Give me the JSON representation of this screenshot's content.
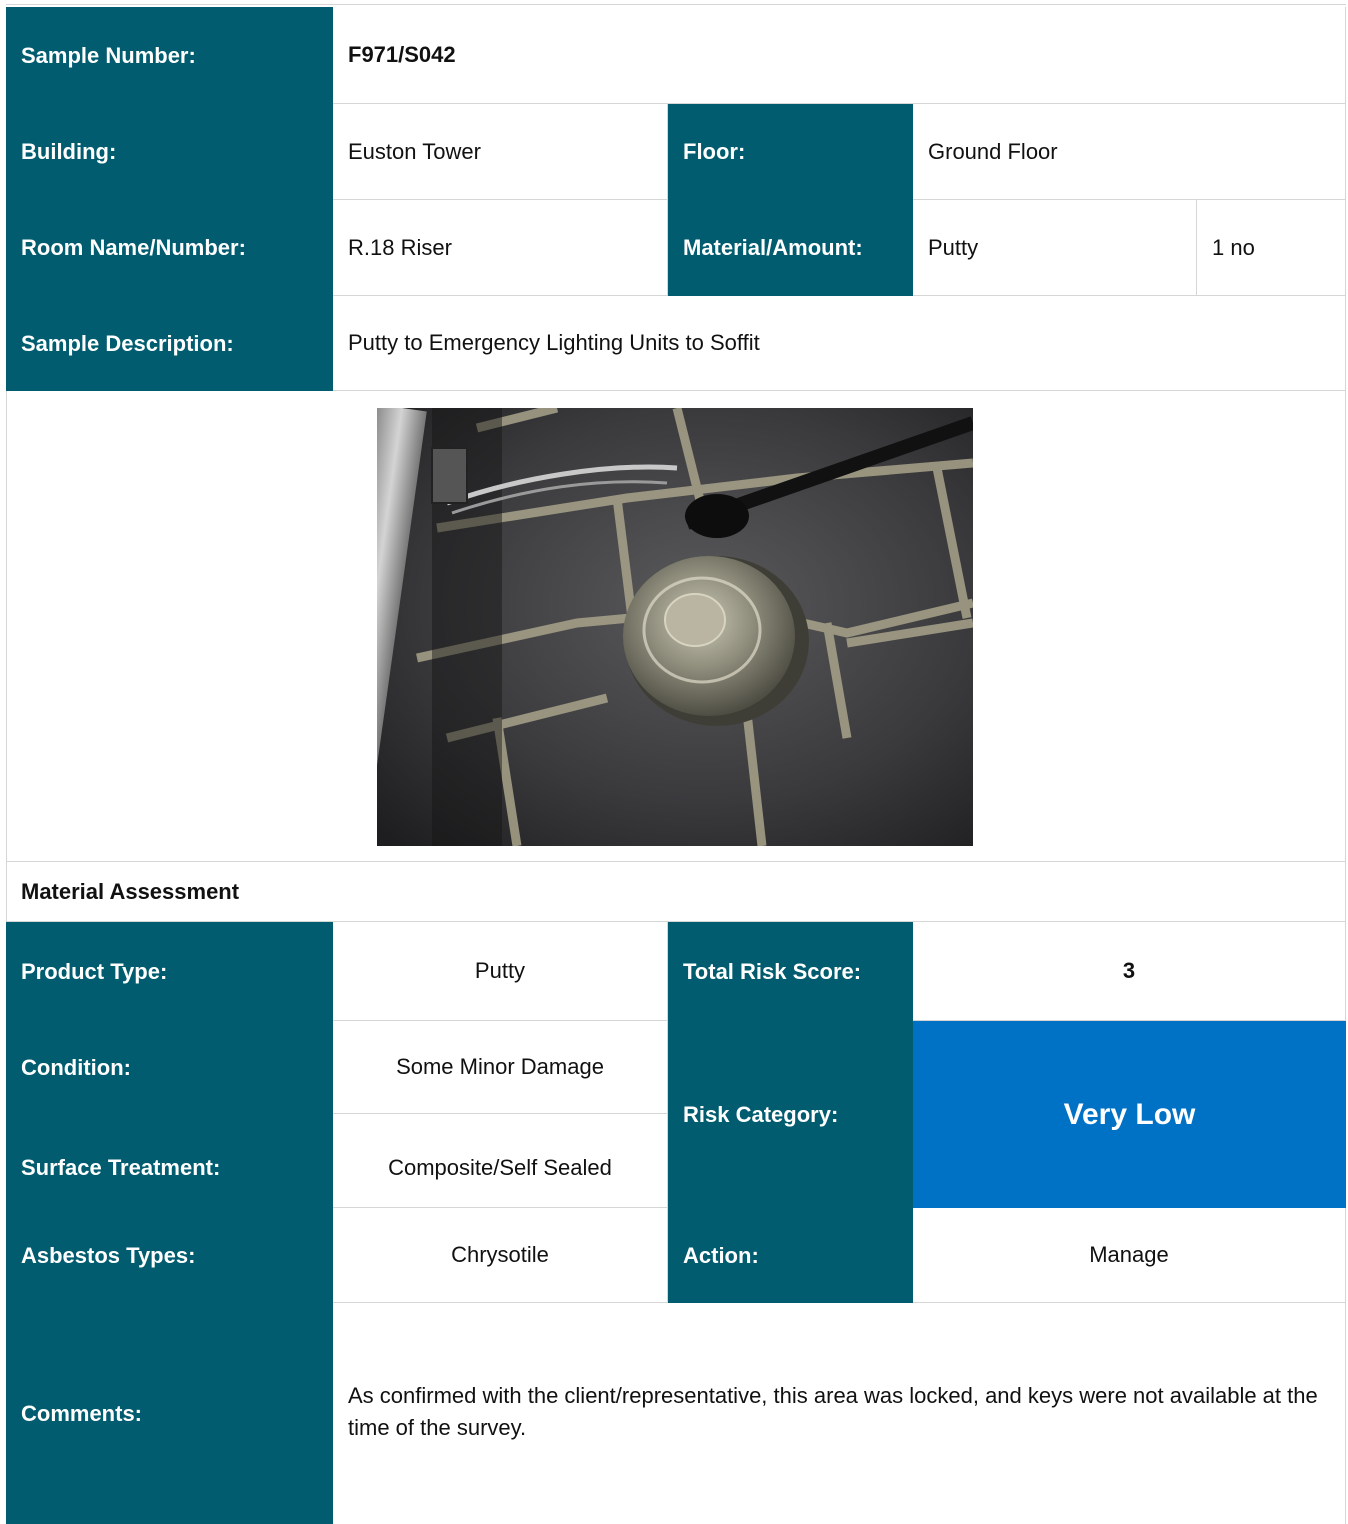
{
  "sample": {
    "label": "Sample Number:",
    "value": "F971/S042"
  },
  "building": {
    "label": "Building:",
    "value": "Euston Tower"
  },
  "floor": {
    "label": "Floor:",
    "value": "Ground Floor"
  },
  "room": {
    "label": "Room Name/Number:",
    "value": "R.18 Riser"
  },
  "material": {
    "label": "Material/Amount:",
    "value": "Putty",
    "amount": "1 no"
  },
  "description": {
    "label": "Sample Description:",
    "value": "Putty to Emergency Lighting Units to Soffit"
  },
  "photo": {
    "icon": "emergency-light-photo"
  },
  "assessment": {
    "heading": "Material Assessment",
    "product_type": {
      "label": "Product Type:",
      "value": "Putty"
    },
    "total_risk": {
      "label": "Total Risk Score:",
      "value": "3"
    },
    "condition": {
      "label": "Condition:",
      "value": "Some Minor Damage"
    },
    "surface": {
      "label": "Surface Treatment:",
      "value": "Composite/Self Sealed"
    },
    "risk_category": {
      "label": "Risk Category:",
      "value": "Very Low",
      "color": "#0072c6"
    },
    "asbestos": {
      "label": "Asbestos Types:",
      "value": "Chrysotile"
    },
    "action": {
      "label": "Action:",
      "value": "Manage"
    },
    "comments": {
      "label": "Comments:",
      "value": "As confirmed with the client/representative, this area was locked, and keys were not available at the time of the survey."
    }
  },
  "colors": {
    "header": "#005c6e",
    "risk": "#0072c6"
  }
}
